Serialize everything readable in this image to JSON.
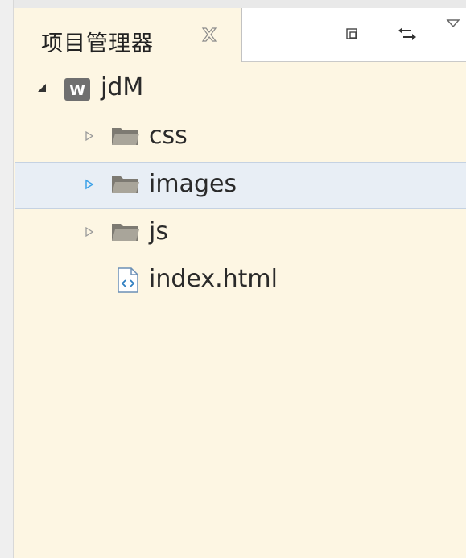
{
  "view": {
    "tab_title": "项目管理器",
    "tab_close_icon": "close-icon",
    "toolbar": {
      "minimize_icon": "minimize-icon",
      "link_icon": "link-with-editor-icon",
      "menu_icon": "view-menu-icon"
    }
  },
  "tree": {
    "project": {
      "label": "jdM",
      "icon": "web-project-icon",
      "expanded": true
    },
    "items": [
      {
        "label": "css",
        "type": "folder",
        "icon": "folder-icon"
      },
      {
        "label": "images",
        "type": "folder",
        "icon": "folder-icon",
        "selected": true
      },
      {
        "label": "js",
        "type": "folder",
        "icon": "folder-icon"
      },
      {
        "label": "index.html",
        "type": "file",
        "icon": "html-file-icon"
      }
    ]
  },
  "colors": {
    "background": "#fdf6e3",
    "selection": "#e8eef5",
    "twisty_active": "#3aa0e8"
  }
}
